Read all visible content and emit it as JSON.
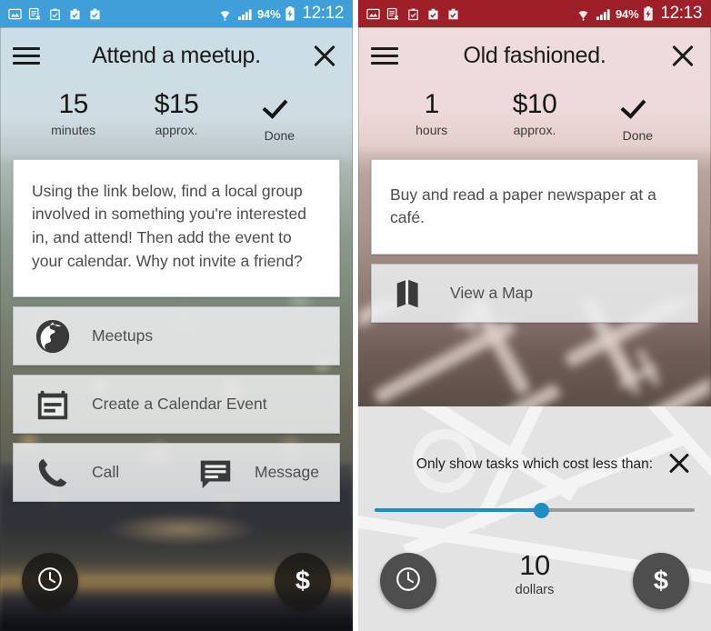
{
  "screens": [
    {
      "id": "left",
      "accent": "#3f9fd8",
      "status_bar": {
        "icons": [
          "image-icon",
          "spreadsheet-error-icon",
          "clipboard-check-icon",
          "briefcase-check-icon",
          "briefcase-check-icon"
        ],
        "wifi_icon": "wifi-icon",
        "signal_icon": "signal-bars-icon",
        "battery_percent": "94%",
        "battery_icon": "battery-charging-icon",
        "clock": "12:12"
      },
      "header": {
        "menu_icon": "hamburger-menu-icon",
        "title": "Attend a meetup.",
        "close_icon": "close-icon"
      },
      "meta": [
        {
          "value": "15",
          "label": "minutes",
          "icon": ""
        },
        {
          "value": "$15",
          "label": "approx.",
          "icon": ""
        },
        {
          "value": "",
          "label": "Done",
          "icon": "checkmark-icon"
        }
      ],
      "description": "Using the link below, find a local group involved in something you're interested in, and attend! Then add the event to your calendar. Why not invite a friend?",
      "actions": [
        {
          "icon": "globe-icon",
          "label": "Meetups"
        },
        {
          "icon": "calendar-icon",
          "label": "Create a Calendar Event"
        }
      ],
      "dual_action": [
        {
          "icon": "phone-icon",
          "label": "Call"
        },
        {
          "icon": "message-icon",
          "label": "Message"
        }
      ],
      "fabs": [
        {
          "icon": "clock-icon",
          "label": ""
        },
        {
          "icon": "dollar-icon",
          "label": "$"
        }
      ]
    },
    {
      "id": "right",
      "accent": "#9e1f28",
      "status_bar": {
        "icons": [
          "image-icon",
          "spreadsheet-error-icon",
          "clipboard-check-icon",
          "briefcase-check-icon",
          "briefcase-check-icon"
        ],
        "wifi_icon": "wifi-icon",
        "signal_icon": "signal-bars-icon",
        "battery_percent": "94%",
        "battery_icon": "battery-charging-icon",
        "clock": "12:13"
      },
      "header": {
        "menu_icon": "hamburger-menu-icon",
        "title": "Old fashioned.",
        "close_icon": "close-icon"
      },
      "meta": [
        {
          "value": "1",
          "label": "hours",
          "icon": ""
        },
        {
          "value": "$10",
          "label": "approx.",
          "icon": ""
        },
        {
          "value": "",
          "label": "Done",
          "icon": "checkmark-icon"
        }
      ],
      "description": "Buy and read a paper newspaper at a café.",
      "actions": [
        {
          "icon": "map-icon",
          "label": "View a Map"
        }
      ],
      "sheet": {
        "title": "Only show tasks which cost less than:",
        "close_icon": "close-icon",
        "slider": {
          "percent": 52,
          "fill_color": "#1e8fc0",
          "track_color": "#9a9a9a"
        },
        "value": "10",
        "unit": "dollars"
      },
      "fabs": [
        {
          "icon": "clock-icon",
          "label": ""
        },
        {
          "icon": "dollar-icon",
          "label": "$"
        }
      ]
    }
  ]
}
